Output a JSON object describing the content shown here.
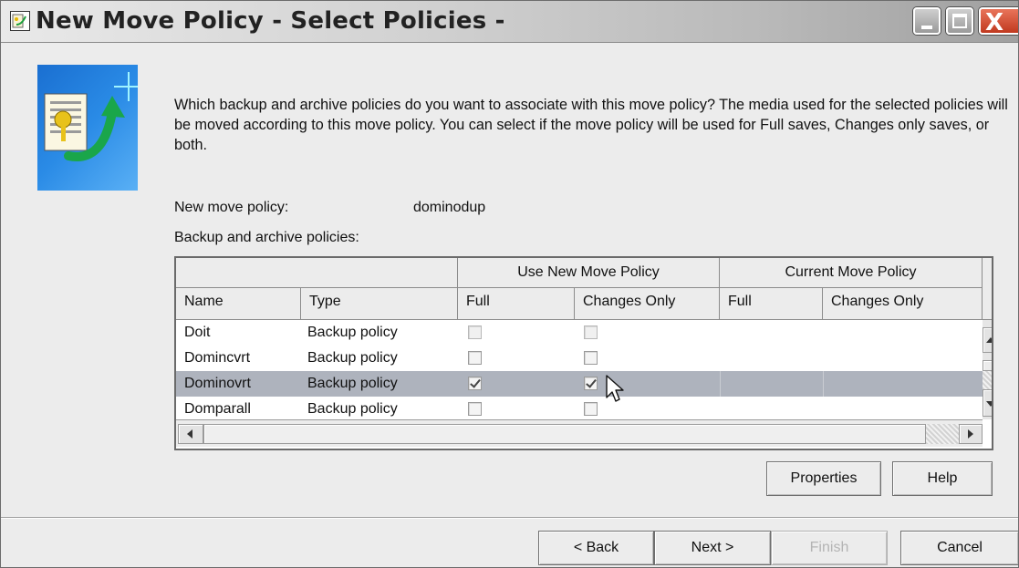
{
  "window": {
    "title": "New Move Policy - Select Policies -",
    "minimize_icon": "minimize-icon",
    "maximize_icon": "maximize-icon",
    "close_icon": "close-icon",
    "close_glyph": "X"
  },
  "banner": {
    "icon": "policy-document-arrow-icon",
    "description": "Which backup and archive policies do you want to associate with this move policy?  The media used for the selected policies will be moved according to this move policy.  You can select if the move policy will be used for Full saves, Changes only saves, or both."
  },
  "move_policy": {
    "label": "New move policy:",
    "value": "dominodup"
  },
  "policies": {
    "label": "Backup and archive policies:",
    "group_headers": [
      "Use New Move Policy",
      "Current Move Policy"
    ],
    "columns": [
      "Name",
      "Type",
      "Full",
      "Changes Only",
      "Full",
      "Changes Only"
    ],
    "rows": [
      {
        "name": "Doit",
        "type": "Backup policy",
        "use_full": false,
        "use_changes": false,
        "enabled": false,
        "selected": false
      },
      {
        "name": "Domincvrt",
        "type": "Backup policy",
        "use_full": false,
        "use_changes": false,
        "enabled": true,
        "selected": false
      },
      {
        "name": "Dominovrt",
        "type": "Backup policy",
        "use_full": true,
        "use_changes": true,
        "enabled": true,
        "selected": true
      },
      {
        "name": "Domparall",
        "type": "Backup policy",
        "use_full": false,
        "use_changes": false,
        "enabled": true,
        "selected": false
      }
    ]
  },
  "buttons": {
    "properties": "Properties",
    "help": "Help",
    "back": "< Back",
    "next": "Next >",
    "finish": "Finish",
    "cancel": "Cancel",
    "finish_enabled": false
  },
  "colors": {
    "selected_row": "#aeb3bd",
    "close_button": "#c0391f",
    "banner_blue": "#1a6fd1"
  }
}
